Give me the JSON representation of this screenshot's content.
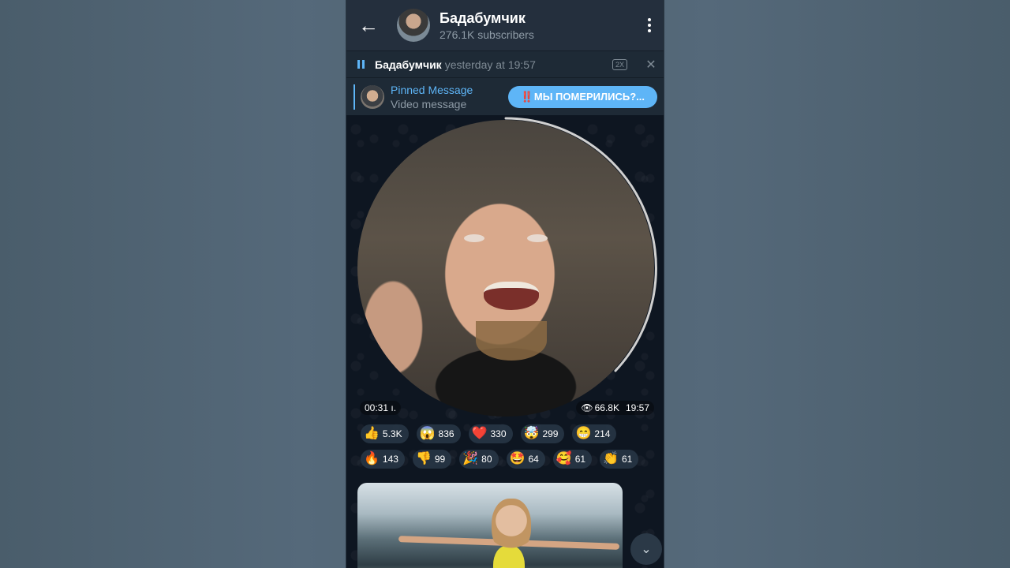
{
  "header": {
    "back_icon": "arrow-left-icon",
    "title": "Бадабумчик",
    "subtitle": "276.1K subscribers",
    "menu_icon": "more-vertical-icon"
  },
  "player": {
    "pause_icon": "pause-icon",
    "name": "Бадабумчик",
    "time": "yesterday at 19:57",
    "speed": "2X",
    "close_icon": "close-icon"
  },
  "pinned": {
    "title": "Pinned Message",
    "subtitle": "Video message",
    "button_label": "МЫ ПОМЕРИЛИСЬ?...",
    "button_prefix": "‼️"
  },
  "video_message": {
    "duration": "00:31",
    "views": "66.8K",
    "time": "19:57",
    "eye_icon": "eye-icon"
  },
  "reactions": [
    [
      {
        "emoji": "👍",
        "count": "5.3K"
      },
      {
        "emoji": "😱",
        "count": "836"
      },
      {
        "emoji": "❤️",
        "count": "330"
      },
      {
        "emoji": "🤯",
        "count": "299"
      },
      {
        "emoji": "😁",
        "count": "214"
      }
    ],
    [
      {
        "emoji": "🔥",
        "count": "143"
      },
      {
        "emoji": "👎",
        "count": "99"
      },
      {
        "emoji": "🎉",
        "count": "80"
      },
      {
        "emoji": "🤩",
        "count": "64"
      },
      {
        "emoji": "🥰",
        "count": "61"
      },
      {
        "emoji": "👏",
        "count": "61"
      }
    ]
  ],
  "colors": {
    "accent": "#5eb5f7",
    "header_bg": "#242f3d",
    "chat_bg": "#0e1621"
  }
}
